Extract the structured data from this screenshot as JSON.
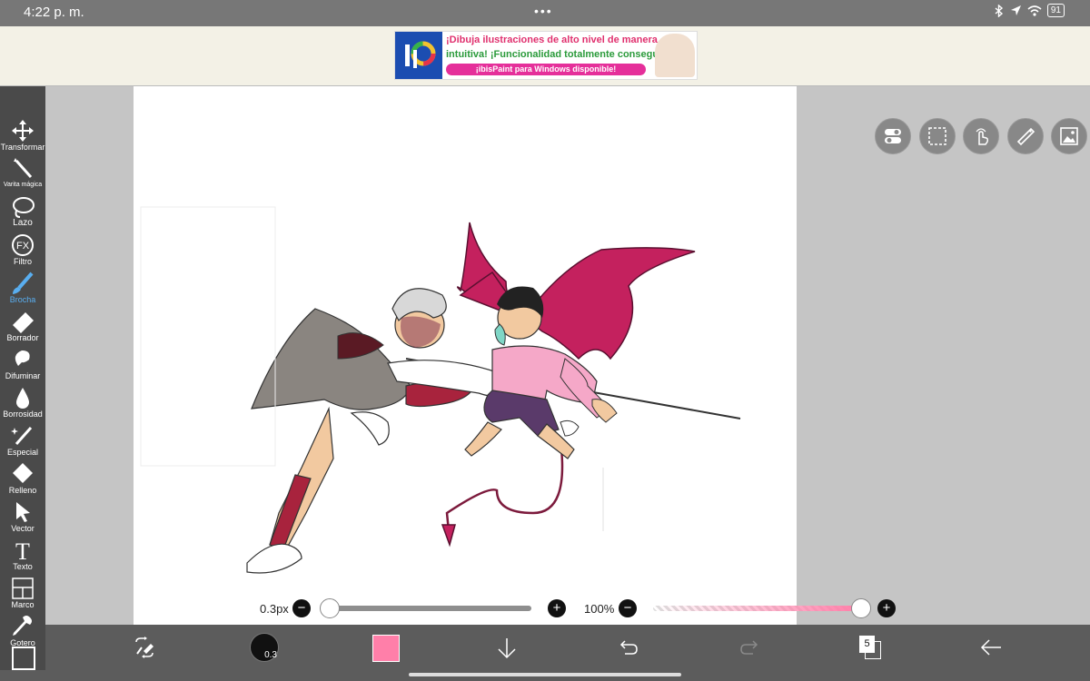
{
  "status": {
    "time": "4:22 p. m.",
    "dots": "•••",
    "battery": "91"
  },
  "ad": {
    "line1": "¡Dibuja ilustraciones de alto nivel de manera",
    "line2": "intuitiva! ¡Funcionalidad totalmente conseguida!",
    "pill": "¡ibisPaint para Windows disponible!"
  },
  "tools": [
    {
      "label": "Transformar",
      "icon": "move-icon"
    },
    {
      "label": "Varita mágica",
      "icon": "magic-wand-icon"
    },
    {
      "label": "Lazo",
      "icon": "lasso-icon"
    },
    {
      "label": "Filtro",
      "icon": "fx-icon"
    },
    {
      "label": "Brocha",
      "icon": "brush-icon",
      "active": true
    },
    {
      "label": "Borrador",
      "icon": "eraser-icon"
    },
    {
      "label": "Difuminar",
      "icon": "smudge-icon"
    },
    {
      "label": "Borrosidad",
      "icon": "blur-icon"
    },
    {
      "label": "Especial",
      "icon": "special-icon"
    },
    {
      "label": "Relleno",
      "icon": "fill-icon"
    },
    {
      "label": "Vector",
      "icon": "vector-icon"
    },
    {
      "label": "Texto",
      "icon": "text-icon"
    },
    {
      "label": "Marco",
      "icon": "frame-icon"
    },
    {
      "label": "Gotero",
      "icon": "eyedropper-icon"
    }
  ],
  "float_buttons": [
    "toggle-icon",
    "selection-icon",
    "touch-icon",
    "ruler-icon",
    "reference-image-icon"
  ],
  "brush": {
    "size_label": "0.3px",
    "size_fraction": 0.0,
    "opacity_label": "100%",
    "opacity_fraction": 1.0
  },
  "bottom": {
    "brush_badge": "0.3",
    "layer_count": "5",
    "color": "#ff7fa9"
  },
  "colors": {
    "wing": "#c4215e",
    "shirt": "#f5a8c8",
    "cloak": "#8a8580",
    "accent": "#59aef0"
  }
}
